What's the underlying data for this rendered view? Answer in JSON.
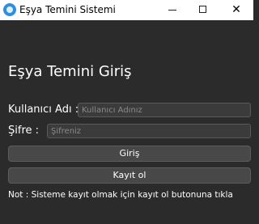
{
  "window": {
    "title": "Eşya Temini Sistemi",
    "icon": "app-logo-icon",
    "controls": {
      "minimize": "minimize-icon",
      "maximize": "maximize-icon",
      "close": "close-icon",
      "close_glyph": "✕"
    }
  },
  "colors": {
    "background": "#2b2b2b",
    "input": "#3b3b3b",
    "button": "#484848",
    "text": "#ffffff"
  },
  "form": {
    "heading": "Eşya Temini Giriş",
    "username_label": "Kullanıcı Adı :",
    "username_placeholder": "Kullanıcı Adınız",
    "password_label": "Şifre :",
    "password_placeholder": "Şifreniz",
    "login_button": "Giriş",
    "register_button": "Kayıt ol",
    "note": "Not : Sisteme kayıt olmak için kayıt ol butonuna tıkla"
  }
}
